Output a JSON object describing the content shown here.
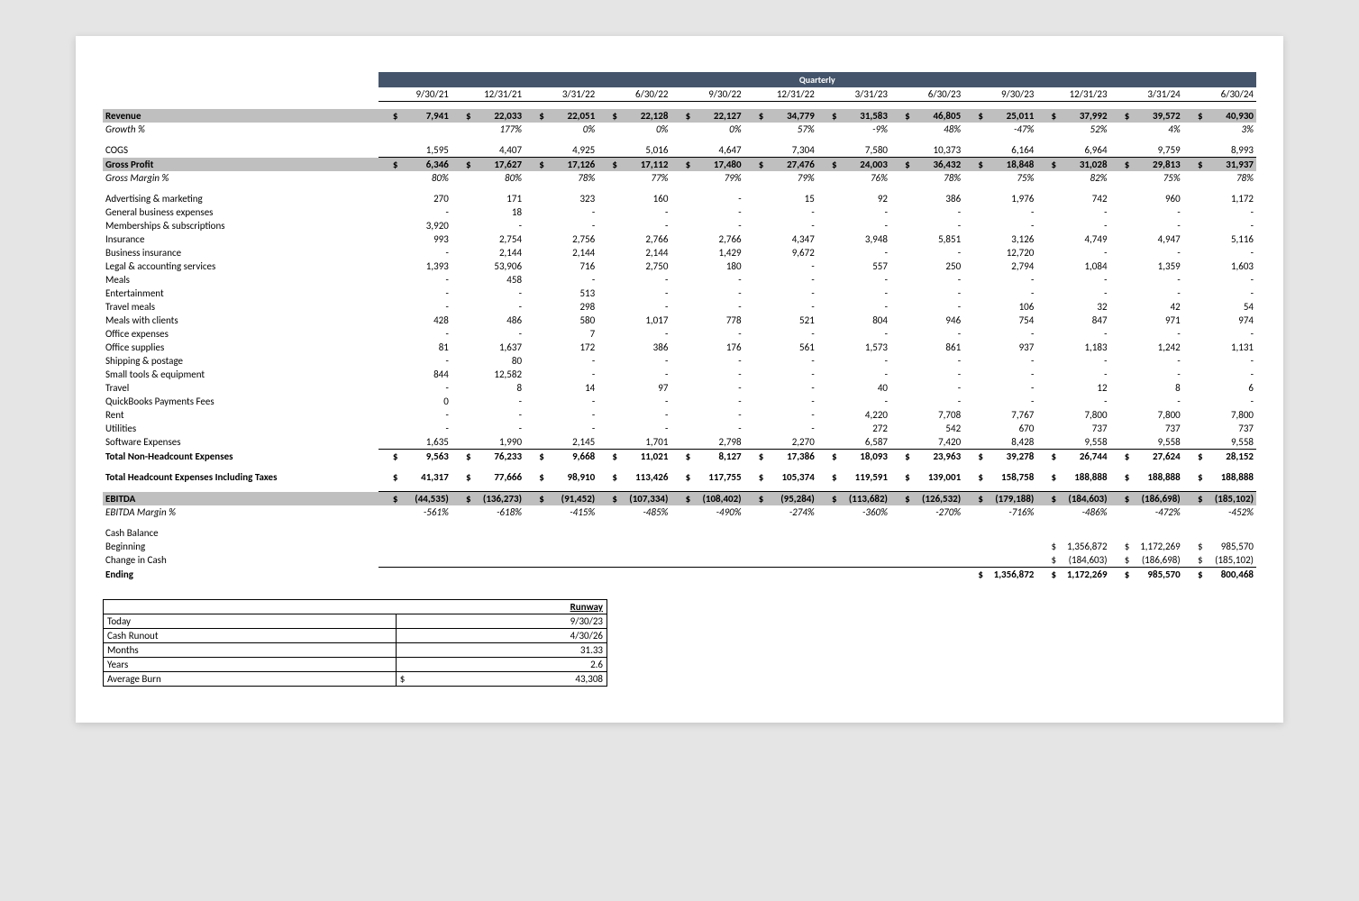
{
  "periodicity": "Quarterly",
  "periods": [
    "9/30/21",
    "12/31/21",
    "3/31/22",
    "6/30/22",
    "9/30/22",
    "12/31/22",
    "3/31/23",
    "6/30/23",
    "9/30/23",
    "12/31/23",
    "3/31/24",
    "6/30/24"
  ],
  "rows": [
    {
      "k": "hl",
      "label": "Revenue",
      "d": true,
      "v": [
        "7,941",
        "22,033",
        "22,051",
        "22,128",
        "22,127",
        "34,779",
        "31,583",
        "46,805",
        "25,011",
        "37,992",
        "39,572",
        "40,930"
      ]
    },
    {
      "k": "ital",
      "label": "Growth %",
      "v": [
        "",
        "177%",
        "0%",
        "0%",
        "0%",
        "57%",
        "-9%",
        "48%",
        "-47%",
        "52%",
        "4%",
        "3%"
      ]
    },
    {
      "k": "sp"
    },
    {
      "k": "",
      "label": "COGS",
      "v": [
        "1,595",
        "4,407",
        "4,925",
        "5,016",
        "4,647",
        "7,304",
        "7,580",
        "10,373",
        "6,164",
        "6,964",
        "9,759",
        "8,993"
      ]
    },
    {
      "k": "hl topline",
      "label": "Gross Profit",
      "d": true,
      "v": [
        "6,346",
        "17,627",
        "17,126",
        "17,112",
        "17,480",
        "27,476",
        "24,003",
        "36,432",
        "18,848",
        "31,028",
        "29,813",
        "31,937"
      ]
    },
    {
      "k": "ital",
      "label": "Gross Margin %",
      "v": [
        "80%",
        "80%",
        "78%",
        "77%",
        "79%",
        "79%",
        "76%",
        "78%",
        "75%",
        "82%",
        "75%",
        "78%"
      ]
    },
    {
      "k": "sp"
    },
    {
      "k": "",
      "label": "Advertising & marketing",
      "v": [
        "270",
        "171",
        "323",
        "160",
        "-",
        "15",
        "92",
        "386",
        "1,976",
        "742",
        "960",
        "1,172"
      ]
    },
    {
      "k": "",
      "label": "General business expenses",
      "v": [
        "-",
        "18",
        "-",
        "-",
        "-",
        "-",
        "-",
        "-",
        "-",
        "-",
        "-",
        "-"
      ]
    },
    {
      "k": "",
      "label": "Memberships & subscriptions",
      "v": [
        "3,920",
        "-",
        "-",
        "-",
        "-",
        "-",
        "-",
        "-",
        "-",
        "-",
        "-",
        "-"
      ]
    },
    {
      "k": "",
      "label": "Insurance",
      "v": [
        "993",
        "2,754",
        "2,756",
        "2,766",
        "2,766",
        "4,347",
        "3,948",
        "5,851",
        "3,126",
        "4,749",
        "4,947",
        "5,116"
      ]
    },
    {
      "k": "",
      "label": "Business insurance",
      "v": [
        "-",
        "2,144",
        "2,144",
        "2,144",
        "1,429",
        "9,672",
        "-",
        "-",
        "12,720",
        "-",
        "-",
        "-"
      ]
    },
    {
      "k": "",
      "label": "Legal & accounting services",
      "v": [
        "1,393",
        "53,906",
        "716",
        "2,750",
        "180",
        "-",
        "557",
        "250",
        "2,794",
        "1,084",
        "1,359",
        "1,603"
      ]
    },
    {
      "k": "",
      "label": "Meals",
      "v": [
        "-",
        "458",
        "-",
        "-",
        "-",
        "-",
        "-",
        "-",
        "-",
        "-",
        "-",
        "-"
      ]
    },
    {
      "k": "",
      "label": "Entertainment",
      "v": [
        "-",
        "-",
        "513",
        "-",
        "-",
        "-",
        "-",
        "-",
        "-",
        "-",
        "-",
        "-"
      ]
    },
    {
      "k": "",
      "label": "Travel meals",
      "v": [
        "-",
        "-",
        "298",
        "-",
        "-",
        "-",
        "-",
        "-",
        "106",
        "32",
        "42",
        "54"
      ]
    },
    {
      "k": "",
      "label": "Meals with clients",
      "v": [
        "428",
        "486",
        "580",
        "1,017",
        "778",
        "521",
        "804",
        "946",
        "754",
        "847",
        "971",
        "974"
      ]
    },
    {
      "k": "",
      "label": "Office expenses",
      "v": [
        "-",
        "-",
        "7",
        "-",
        "-",
        "-",
        "-",
        "-",
        "-",
        "-",
        "-",
        "-"
      ]
    },
    {
      "k": "",
      "label": "Office supplies",
      "v": [
        "81",
        "1,637",
        "172",
        "386",
        "176",
        "561",
        "1,573",
        "861",
        "937",
        "1,183",
        "1,242",
        "1,131"
      ]
    },
    {
      "k": "",
      "label": "Shipping & postage",
      "v": [
        "-",
        "80",
        "-",
        "-",
        "-",
        "-",
        "-",
        "-",
        "-",
        "-",
        "-",
        "-"
      ]
    },
    {
      "k": "",
      "label": "Small tools & equipment",
      "v": [
        "844",
        "12,582",
        "-",
        "-",
        "-",
        "-",
        "-",
        "-",
        "-",
        "-",
        "-",
        "-"
      ]
    },
    {
      "k": "",
      "label": "Travel",
      "v": [
        "-",
        "8",
        "14",
        "97",
        "-",
        "-",
        "40",
        "-",
        "-",
        "12",
        "8",
        "6"
      ]
    },
    {
      "k": "",
      "label": "QuickBooks Payments Fees",
      "v": [
        "0",
        "-",
        "-",
        "-",
        "-",
        "-",
        "-",
        "-",
        "-",
        "-",
        "-",
        "-"
      ]
    },
    {
      "k": "",
      "label": "Rent",
      "v": [
        "-",
        "-",
        "-",
        "-",
        "-",
        "-",
        "4,220",
        "7,708",
        "7,767",
        "7,800",
        "7,800",
        "7,800"
      ]
    },
    {
      "k": "",
      "label": "Utilities",
      "v": [
        "-",
        "-",
        "-",
        "-",
        "-",
        "-",
        "272",
        "542",
        "670",
        "737",
        "737",
        "737"
      ]
    },
    {
      "k": "",
      "label": "Software Expenses",
      "v": [
        "1,635",
        "1,990",
        "2,145",
        "1,701",
        "2,798",
        "2,270",
        "6,587",
        "7,420",
        "8,428",
        "9,558",
        "9,558",
        "9,558"
      ]
    },
    {
      "k": "bold topline",
      "label": "Total Non-Headcount Expenses",
      "d": true,
      "v": [
        "9,563",
        "76,233",
        "9,668",
        "11,021",
        "8,127",
        "17,386",
        "18,093",
        "23,963",
        "39,278",
        "26,744",
        "27,624",
        "28,152"
      ]
    },
    {
      "k": "sp"
    },
    {
      "k": "bold",
      "label": "Total Headcount Expenses Including Taxes",
      "d": true,
      "v": [
        "41,317",
        "77,666",
        "98,910",
        "113,426",
        "117,755",
        "105,374",
        "119,591",
        "139,001",
        "158,758",
        "188,888",
        "188,888",
        "188,888"
      ]
    },
    {
      "k": "sp"
    },
    {
      "k": "hl topline",
      "label": "EBITDA",
      "d": true,
      "v": [
        "(44,535)",
        "(136,273)",
        "(91,452)",
        "(107,334)",
        "(108,402)",
        "(95,284)",
        "(113,682)",
        "(126,532)",
        "(179,188)",
        "(184,603)",
        "(186,698)",
        "(185,102)"
      ]
    },
    {
      "k": "ital",
      "label": "EBITDA Margin %",
      "v": [
        "-561%",
        "-618%",
        "-415%",
        "-485%",
        "-490%",
        "-274%",
        "-360%",
        "-270%",
        "-716%",
        "-486%",
        "-472%",
        "-452%"
      ]
    },
    {
      "k": "sp"
    },
    {
      "k": "",
      "label": "Cash Balance",
      "v": [
        "",
        "",
        "",
        "",
        "",
        "",
        "",
        "",
        "",
        "",
        "",
        ""
      ]
    },
    {
      "k": "",
      "label": "Beginning",
      "d": true,
      "v": [
        "",
        "",
        "",
        "",
        "",
        "",
        "",
        "",
        "",
        "1,356,872",
        "1,172,269",
        "985,570"
      ]
    },
    {
      "k": "",
      "label": "Change in Cash",
      "d": true,
      "v": [
        "",
        "",
        "",
        "",
        "",
        "",
        "",
        "",
        "",
        "(184,603)",
        "(186,698)",
        "(185,102)"
      ]
    },
    {
      "k": "bold topline",
      "label": "Ending",
      "d": true,
      "v": [
        "",
        "",
        "",
        "",
        "",
        "",
        "",
        "",
        "1,356,872",
        "1,172,269",
        "985,570",
        "800,468"
      ]
    }
  ],
  "runway": {
    "title": "Runway",
    "items": [
      {
        "label": "Today",
        "value": "9/30/23"
      },
      {
        "label": "Cash Runout",
        "value": "4/30/26"
      },
      {
        "label": "Months",
        "value": "31.33"
      },
      {
        "label": "Years",
        "value": "2.6"
      },
      {
        "label": "Average Burn",
        "value": "43,308",
        "d": true
      }
    ]
  }
}
